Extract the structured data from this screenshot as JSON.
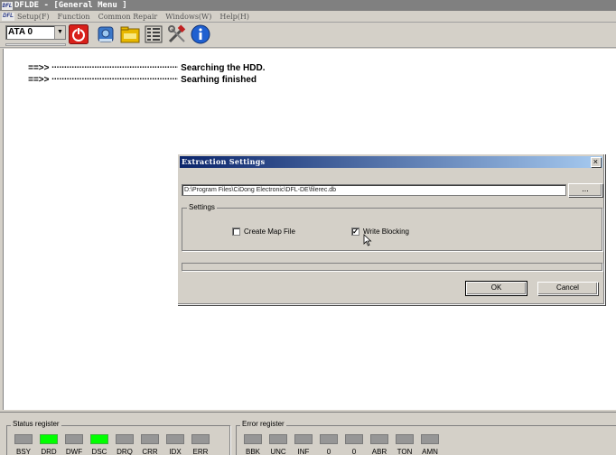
{
  "window": {
    "logo": "DFL",
    "title": "DFLDE - [General Menu ]"
  },
  "menu": {
    "logo": "DFL",
    "items": [
      "Setup(F)",
      "Function",
      "Common Repair",
      "Windows(W)",
      "Help(H)"
    ]
  },
  "toolbar": {
    "drive_value": "ATA 0",
    "buttons": [
      "power-icon",
      "disk-icon",
      "folder-icon",
      "list-icon",
      "tools-icon",
      "info-icon"
    ]
  },
  "log": {
    "lines": [
      {
        "arrow": "==>>",
        "dots": "....................................................",
        "message": "Searching the HDD."
      },
      {
        "arrow": "==>>",
        "dots": "....................................................",
        "message": "Searhing finished"
      }
    ]
  },
  "dialog": {
    "title": "Extraction Settings",
    "close_label": "×",
    "path_value": "D:\\Program Files\\CiDong Electronic\\DFL-DE\\filerec.db",
    "browse_label": "...",
    "settings_legend": "Settings",
    "create_map_label": "Create Map File",
    "create_map_checked": "",
    "write_blocking_label": "Write Blocking",
    "write_blocking_checked": "✓",
    "ok_label": "OK",
    "cancel_label": "Cancel"
  },
  "status_register": {
    "legend": "Status register",
    "leds": [
      {
        "label": "BSY",
        "on": false
      },
      {
        "label": "DRD",
        "on": true
      },
      {
        "label": "DWF",
        "on": false
      },
      {
        "label": "DSC",
        "on": true
      },
      {
        "label": "DRQ",
        "on": false
      },
      {
        "label": "CRR",
        "on": false
      },
      {
        "label": "IDX",
        "on": false
      },
      {
        "label": "ERR",
        "on": false
      }
    ]
  },
  "error_register": {
    "legend": "Error register",
    "leds": [
      {
        "label": "BBK",
        "on": false
      },
      {
        "label": "UNC",
        "on": false
      },
      {
        "label": "INF",
        "on": false
      },
      {
        "label": "0",
        "on": false
      },
      {
        "label": "0",
        "on": false
      },
      {
        "label": "ABR",
        "on": false
      },
      {
        "label": "TON",
        "on": false
      },
      {
        "label": "AMN",
        "on": false
      }
    ]
  },
  "colors": {
    "led_on": "#00ff00",
    "led_off": "#969696",
    "dialog_title_start": "#0a246a",
    "dialog_title_end": "#a6caf0"
  }
}
